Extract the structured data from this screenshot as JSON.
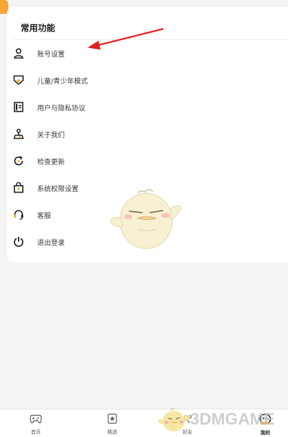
{
  "section": {
    "title": "常用功能"
  },
  "menu": [
    {
      "label": "账号设置",
      "icon": "user-icon"
    },
    {
      "label": "儿童/青少年模式",
      "icon": "shield-child-icon"
    },
    {
      "label": "用户与隐私协议",
      "icon": "document-icon"
    },
    {
      "label": "关于我们",
      "icon": "joystick-icon"
    },
    {
      "label": "检查更新",
      "icon": "refresh-icon"
    },
    {
      "label": "系统权限设置",
      "icon": "lock-box-icon"
    },
    {
      "label": "客服",
      "icon": "headset-icon"
    },
    {
      "label": "退出登录",
      "icon": "power-icon"
    }
  ],
  "nav": [
    {
      "label": "首页",
      "icon": "gamepad-icon"
    },
    {
      "label": "精选",
      "icon": "star-card-icon"
    },
    {
      "label": "好友",
      "icon": "friends-icon"
    },
    {
      "label": "我的",
      "icon": "profile-icon"
    }
  ],
  "watermark": {
    "text": "3DMGAME"
  },
  "colors": {
    "accent": "#f7a535",
    "arrow": "#e02020",
    "icon": "#1a1a1a"
  }
}
